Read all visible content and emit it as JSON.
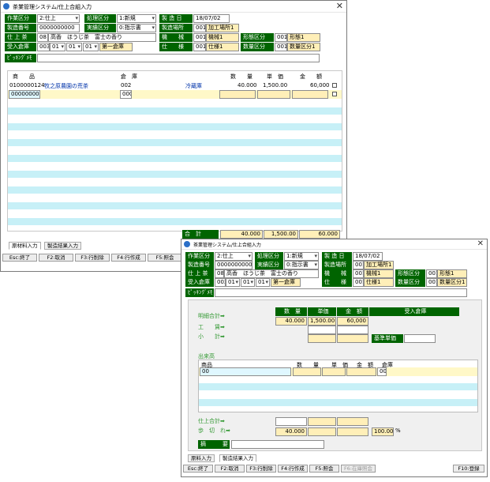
{
  "win1": {
    "title": "茶業管理システム/仕上合組入力",
    "close": "✕",
    "header": {
      "sagyo_label": "作業区分",
      "sagyo_value": "2:仕上",
      "shori_label": "処理区分",
      "shori_value": "1:新規",
      "seizo_bi_label": "製 造 日",
      "seizo_bi_value": "18/07/02",
      "seizo_no_label": "製造番号",
      "seizo_no_value": "0000000000",
      "jisseki_label": "実績区分",
      "jisseki_value": "0:指示書",
      "seizo_basho_label": "製造場所",
      "seizo_basho_code": "001",
      "seizo_basho_name": "加工場所1",
      "shiage_label": "仕 上 茶",
      "shiage_code": "08",
      "shiage_name": "高香　ほうじ茶　富士の香り",
      "kikai_label": "機　　械",
      "kikai_code": "001",
      "kikai_name": "機械1",
      "keijo_label": "形態区分",
      "keijo_code": "001",
      "keijo_name": "形態1",
      "ukeire_label": "受入倉庫",
      "ukeire_code": "003",
      "ukeire_sel1": "01",
      "ukeire_sel2": "01",
      "ukeire_sel3": "01",
      "ukeire_name": "第一倉庫",
      "shiyo_label": "仕　　様",
      "shiyo_code": "001",
      "shiyo_name": "仕様1",
      "suryo_label": "数量区分",
      "suryo_code": "001",
      "suryo_name": "数量区分1",
      "picking_label": "ﾋﾟｯｷﾝｸﾞﾒﾓ"
    },
    "grid": {
      "col_shohin": "商　　品",
      "col_soko": "倉　庫",
      "col_suryo": "数　　量",
      "col_tanka": "単　価",
      "col_kingaku": "金　　額",
      "row1": {
        "code": "0100000124",
        "name": "牧之原農園の荒茶",
        "soko": "002",
        "soko_name": "冷蔵庫",
        "suryo": "40.000",
        "tanka": "1,500.00",
        "kingaku": "60,000"
      },
      "row2": {
        "code": "000000000",
        "soko": "000"
      }
    },
    "total": {
      "label": "合　計",
      "suryo": "40.000",
      "tanka": "1,500.00",
      "kingaku": "60.000"
    },
    "tabs": [
      "原材料入力",
      "製造結果入力"
    ],
    "fkeys": [
      "Esc:終了",
      "F2:取消",
      "F3:行削除",
      "F4:行作成",
      "F5:照会"
    ]
  },
  "win2": {
    "title": "茶業管理システム/仕上合組入力",
    "close": "✕",
    "header": {
      "sagyo_label": "作業区分",
      "sagyo_value": "2:仕上",
      "shori_label": "処理区分",
      "shori_value": "1:新規",
      "seizo_bi_label": "製 造 日",
      "seizo_bi_value": "18/07/02",
      "seizo_no_label": "製造番号",
      "seizo_no_value": "0000000000",
      "jisseki_label": "実績区分",
      "jisseki_value": "0:指示書",
      "seizo_basho_label": "製造場所",
      "seizo_basho_code": "001",
      "seizo_basho_name": "加工場所1",
      "shiage_label": "仕 上 茶",
      "shiage_code": "08",
      "shiage_name": "高香　ほうじ茶　富士の香り",
      "kikai_label": "機　　械",
      "kikai_code": "001",
      "kikai_name": "機械1",
      "keijo_label": "形態区分",
      "keijo_code": "001",
      "keijo_name": "形態1",
      "ukeire_label": "受入倉庫",
      "ukeire_code": "003",
      "ukeire_sel1": "01",
      "ukeire_sel2": "01",
      "ukeire_sel3": "01",
      "ukeire_name": "第一倉庫",
      "shiyo_label": "仕　　様",
      "shiyo_code": "001",
      "shiyo_name": "仕様1",
      "suryo_label": "数量区分",
      "suryo_code": "001",
      "suryo_name": "数量区分1",
      "picking_label": "ﾋﾟｯｷﾝｸﾞﾒﾓ"
    },
    "summary": {
      "h_suryo": "数　量",
      "h_tanka": "単価",
      "h_kingaku": "金　額",
      "h_ukeire": "受入倉庫",
      "meisai_label": "明細合計➡",
      "meisai_suryo": "40.000",
      "meisai_tanka": "1,500.00",
      "meisai_kingaku": "60,000",
      "kouchin_label": "工　　賃➡",
      "shokei_label": "小　　計➡",
      "kijun_label": "基準単価"
    },
    "dekidaka": {
      "title": "出来高",
      "col_shohin": "商品",
      "col_suryo": "数　　量",
      "col_tanka": "単　価",
      "col_kingaku": "金　額",
      "col_soko": "倉庫",
      "row1_code": "00",
      "row1_soko": "000"
    },
    "bottom": {
      "shiage_label": "仕上合計➡",
      "budomari_label": "歩　切　れ➡",
      "budomari_suryo": "40.000",
      "budomari_pct": "100.00",
      "pct_unit": "%",
      "biko_label": "摘　　　要"
    },
    "tabs": [
      "原料入力",
      "製造結果入力"
    ],
    "fkeys": [
      "Esc:終了",
      "F2:取消",
      "F3:行削除",
      "F4:行作成",
      "F5:照会",
      "F6:在庫照会"
    ],
    "f10": "F10:登録"
  }
}
